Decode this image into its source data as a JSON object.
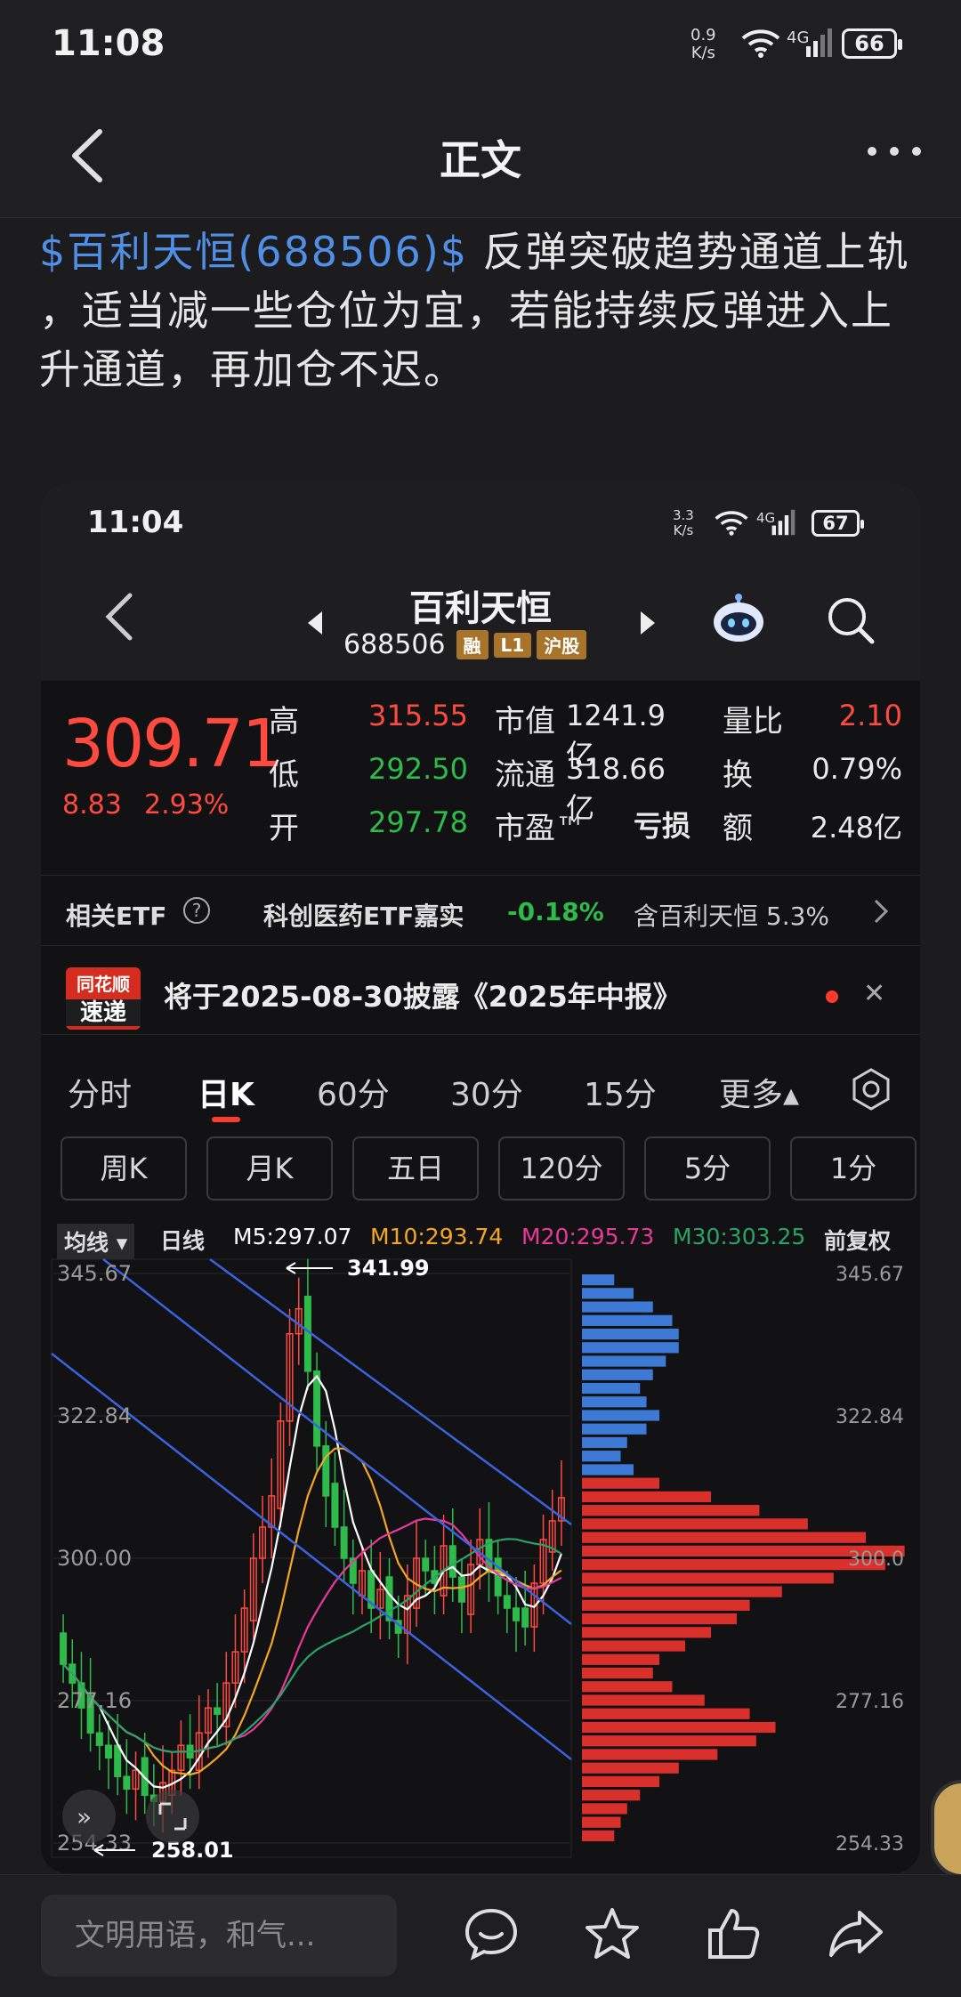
{
  "status_bar": {
    "time": "11:08",
    "net_speed_value": "0.9",
    "net_speed_unit": "K/s",
    "network": "4G",
    "battery": "66"
  },
  "header": {
    "title": "正文",
    "back_icon": "chevron-left-icon",
    "more_icon": "more-horizontal-icon"
  },
  "article": {
    "stock_link": "$百利天恒(688506)$",
    "text_line1": " 反弹突破趋势通道上轨",
    "text_line2": "，适当减一些仓位为宜，若能持续反弹进入上",
    "text_line3": "升通道，再加仓不迟。"
  },
  "screenshot": {
    "status": {
      "time": "11:04",
      "net_speed_value": "3.3",
      "net_speed_unit": "K/s",
      "network": "4G",
      "battery": "67"
    },
    "stock": {
      "name": "百利天恒",
      "code": "688506",
      "tags": [
        "融",
        "L1",
        "沪股"
      ]
    },
    "quote": {
      "price": "309.71",
      "change": "8.83",
      "change_pct": "2.93%",
      "high_label": "高",
      "high": "315.55",
      "low_label": "低",
      "low": "292.50",
      "open_label": "开",
      "open": "297.78",
      "mktcap_label": "市值",
      "mktcap": "1241.9亿",
      "float_label": "流通",
      "float": "318.66亿",
      "pe_label": "市盈™",
      "pe": "亏损",
      "vol_ratio_label": "量比",
      "vol_ratio": "2.10",
      "turnover_label": "换",
      "turnover": "0.79%",
      "amount_label": "额",
      "amount": "2.48亿"
    },
    "etf": {
      "label": "相关ETF",
      "help": "?",
      "fund": "科创医药ETF嘉实",
      "fund_change": "-0.18%",
      "holding": "含百利天恒 5.3%"
    },
    "news": {
      "logo_top": "同花顺",
      "logo_bottom": "速递",
      "text": "将于2025-08-30披露《2025年中报》"
    },
    "period_tabs": [
      "分时",
      "日K",
      "60分",
      "30分",
      "15分",
      "更多▴"
    ],
    "active_tab": "日K",
    "sub_tabs": [
      "周K",
      "月K",
      "五日",
      "120分",
      "5分",
      "1分"
    ],
    "ma_row": {
      "selector": "均线 ▾",
      "kind": "日线",
      "m5": "M5:297.07",
      "m10": "M10:293.74",
      "m20": "M20:295.73",
      "m30": "M30:303.25",
      "adjust": "前复权"
    },
    "chart_labels": {
      "high_marker": "341.99",
      "low_marker": "258.01",
      "y_ticks": [
        "345.67",
        "322.84",
        "300.00",
        "277.16",
        "254.33"
      ],
      "profile_ticks": [
        "345.67",
        "322.84",
        "300.0",
        "277.16",
        "254.33"
      ]
    }
  },
  "bottom_bar": {
    "comment_placeholder": "文明用语，和气...",
    "icons": [
      "comment-icon",
      "star-icon",
      "like-icon",
      "share-icon"
    ]
  },
  "colors": {
    "up": "#ff4a40",
    "down": "#2fbb4b",
    "link": "#4f8fe6",
    "m5": "#ffffff",
    "m10": "#f5a623",
    "m20": "#e8399a",
    "m30": "#29a36a",
    "channel": "#3b63e0"
  },
  "chart_data": {
    "type": "candlestick",
    "title": "",
    "ylim": [
      254.33,
      345.67
    ],
    "y_ticks": [
      345.67,
      322.84,
      300.0,
      277.16,
      254.33
    ],
    "annotations": [
      {
        "label": "341.99",
        "kind": "period-high"
      },
      {
        "label": "258.01",
        "kind": "period-low"
      }
    ],
    "series": [
      {
        "name": "M5",
        "last": 297.07
      },
      {
        "name": "M10",
        "last": 293.74
      },
      {
        "name": "M20",
        "last": 295.73
      },
      {
        "name": "M30",
        "last": 303.25
      }
    ],
    "closes": [
      283,
      280,
      276,
      272,
      270,
      268,
      265,
      263,
      266,
      262,
      261,
      264,
      266,
      270,
      268,
      272,
      276,
      275,
      280,
      285,
      292,
      300,
      305,
      310,
      322,
      336,
      340,
      330,
      318,
      310,
      305,
      300,
      296,
      298,
      292,
      295,
      290,
      288,
      294,
      300,
      298,
      296,
      302,
      297,
      293,
      299,
      303,
      298,
      294,
      292,
      290,
      289,
      296,
      303,
      306,
      309.71
    ],
    "volume_profile": [
      0.1,
      0.16,
      0.22,
      0.28,
      0.3,
      0.3,
      0.26,
      0.22,
      0.18,
      0.2,
      0.24,
      0.2,
      0.14,
      0.12,
      0.16,
      0.24,
      0.4,
      0.55,
      0.7,
      0.88,
      1.0,
      0.94,
      0.78,
      0.62,
      0.52,
      0.48,
      0.4,
      0.32,
      0.24,
      0.22,
      0.28,
      0.38,
      0.52,
      0.6,
      0.54,
      0.42,
      0.3,
      0.24,
      0.18,
      0.14,
      0.12,
      0.1
    ]
  }
}
